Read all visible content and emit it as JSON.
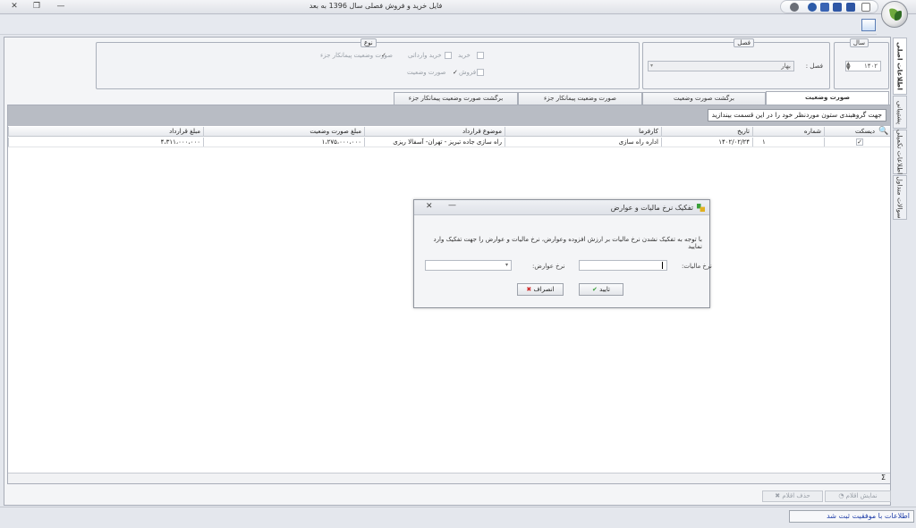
{
  "window": {
    "title": "فایل خرید و فروش فصلی سال 1396 به بعد",
    "close_glyph": "✕",
    "restore_glyph": "❐",
    "minimize_glyph": "—"
  },
  "side_tabs": [
    "اطلاعات اصلی",
    "پشتیبانی",
    "اطلاعات تکمیلی",
    "سوالات متداول"
  ],
  "filters": {
    "year_legend": "سال",
    "year_value": "۱۴۰۲",
    "season_legend": "فصل",
    "season_label": "فصل :",
    "season_value": "بهار",
    "type_legend": "نوع",
    "type_options": [
      {
        "label": "خرید",
        "checked": false,
        "enabled": false
      },
      {
        "label": "خرید وارداتی",
        "checked": false,
        "enabled": false
      },
      {
        "label": "صورت وضعیت پیمانکار جزء",
        "checked": true,
        "enabled": false
      },
      {
        "label": "فروش",
        "checked": true,
        "enabled": false
      },
      {
        "label": "صورت وضعیت",
        "checked": false,
        "enabled": false
      }
    ]
  },
  "tabs": [
    {
      "label": "صورت وضعیت",
      "active": true
    },
    {
      "label": "برگشت صورت وضعیت",
      "active": false
    },
    {
      "label": "صورت وضعیت پیمانکار جزء",
      "active": false
    },
    {
      "label": "برگشت صورت وضعیت پیمانکار جزء",
      "active": false
    }
  ],
  "grid": {
    "group_hint": "جهت گروهبندی ستون موردنظر خود را در این قسمت بیندازید",
    "columns": [
      "دیسکت",
      "شماره",
      "تاریخ",
      "کارفرما",
      "موضوع قرارداد",
      "مبلغ صورت وضعیت",
      "مبلغ قرارداد"
    ],
    "rows": [
      {
        "disk": true,
        "number": "۱",
        "date": "۱۴۰۲/۰۲/۲۴",
        "employer": "اداره راه سازی",
        "subject": "راه سازی جاده تبریز - تهران- آسفالا ریزی",
        "statement_amount": "۱،۲۷۵،۰۰۰،۰۰۰",
        "contract_amount": "۴،۳۱۱،۰۰۰،۰۰۰"
      }
    ],
    "footer_symbol": "Σ"
  },
  "bottom_buttons": {
    "show_items": "نمایش اقلام",
    "delete_items": "حذف اقلام"
  },
  "status": {
    "message": "اطلاعات با موفقیت ثبت شد"
  },
  "modal": {
    "title": "تفکیک نرخ مالیات و عوارض",
    "description": "با توجه به تفکیک نشدن نرخ مالیات بر ارزش افزوده وعوارض، نرخ مالیات و عوارض را جهت تفکیک وارد نمایید",
    "tax_rate_label": "نرخ مالیات:",
    "tax_rate_value": "",
    "duty_rate_label": "نرخ عوارض:",
    "duty_rate_value": "",
    "ok_label": "تایید",
    "cancel_label": "انصراف",
    "close_glyph": "✕",
    "minimize_glyph": "—"
  },
  "colors": {
    "accent_blue": "#1f3ea8",
    "ok_green": "#3aa03a",
    "cancel_red": "#d02a2a"
  }
}
